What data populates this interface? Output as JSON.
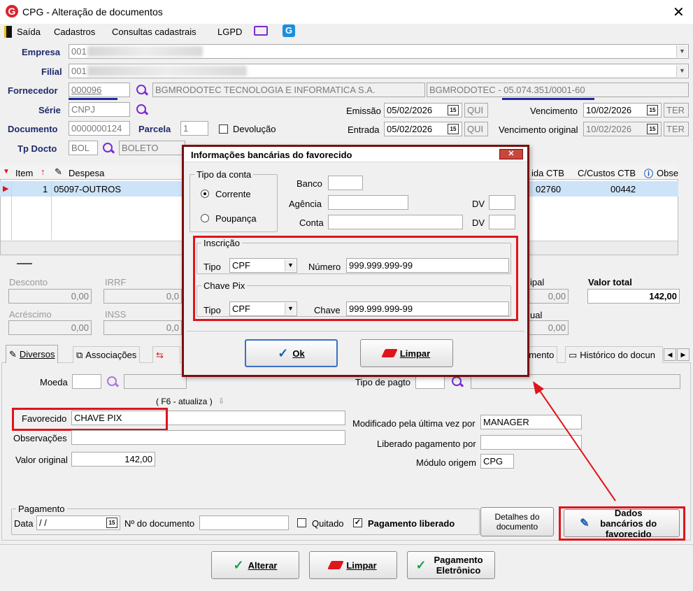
{
  "window": {
    "title": "CPG - Alteração de documentos"
  },
  "menu": {
    "saida": "Saída",
    "cadastros": "Cadastros",
    "consultas": "Consultas cadastrais",
    "lgpd": "LGPD"
  },
  "header": {
    "empresa_label": "Empresa",
    "empresa_value": "001",
    "filial_label": "Filial",
    "filial_value": "001",
    "fornecedor_label": "Fornecedor",
    "fornecedor_code": "000096",
    "fornecedor_name": "BGMRODOTEC TECNOLOGIA E INFORMATICA S.A.",
    "fornecedor_cnpj": "BGMRODOTEC - 05.074.351/0001-60",
    "serie_label": "Série",
    "serie_value": "CNPJ",
    "documento_label": "Documento",
    "documento_value": "0000000124",
    "parcela_label": "Parcela",
    "parcela_value": "1",
    "devolucao_label": "Devolução",
    "tpdocto_label": "Tp Docto",
    "tpdocto_code": "BOL",
    "tpdocto_name": "BOLETO",
    "emissao_label": "Emissão",
    "emissao_value": "05/02/2026",
    "emissao_day": "QUI",
    "entrada_label": "Entrada",
    "entrada_value": "05/02/2026",
    "entrada_day": "QUI",
    "vencimento_label": "Vencimento",
    "vencimento_value": "10/02/2026",
    "vencimento_day": "TER",
    "venc_original_label": "Vencimento original",
    "venc_original_value": "10/02/2026",
    "venc_original_day": "TER",
    "calendar_icon_text": "15"
  },
  "grid": {
    "col_item": "Item",
    "col_despesa": "Despesa",
    "col_ctb": "ida CTB",
    "col_ccustos": "C/Custos CTB",
    "col_obs": "Obse",
    "row1": {
      "item": "1",
      "despesa": "05097-OUTROS",
      "ctb": "02760",
      "ccustos": "00442"
    }
  },
  "totals": {
    "desconto_label": "Desconto",
    "desconto_value": "0,00",
    "irrf_label": "IRRF",
    "irrf_value": "0,0",
    "acrescimo_label": "Acréscimo",
    "acrescimo_value": "0,00",
    "inss_label": "INSS",
    "inss_value": "0,0",
    "principal_label": "ipal",
    "principal_value": "0,00",
    "ual_label": "ual",
    "ual_value": "0,00",
    "valor_total_label": "Valor total",
    "valor_total_value": "142,00"
  },
  "tabs": {
    "diversos": "Diversos",
    "associacoes": "Associações",
    "documento": "umento",
    "historico": "Histórico do docun"
  },
  "diversos": {
    "moeda_label": "Moeda",
    "f6_hint": "( F6 - atualiza )",
    "favorecido_label": "Favorecido",
    "favorecido_value": "CHAVE PIX",
    "observacoes_label": "Observações",
    "valor_original_label": "Valor original",
    "valor_original_value": "142,00",
    "tipo_pagto_label": "Tipo de pagto",
    "modificado_label": "Modificado pela última vez por",
    "modificado_value": "MANAGER",
    "liberado_label": "Liberado pagamento por",
    "modulo_label": "Módulo origem",
    "modulo_value": "CPG",
    "pagamento_legend": "Pagamento",
    "data_label": "Data",
    "data_value": " / /",
    "ndoc_label": "Nº do documento",
    "quitado_label": "Quitado",
    "pag_liberado_label": "Pagamento liberado",
    "detalhes_btn": "Detalhes do documento",
    "dados_bancarios_btn": "Dados bancários do favorecido"
  },
  "footer": {
    "alterar": "Alterar",
    "limpar": "Limpar",
    "pagamento_eletronico": "Pagamento Eletrônico"
  },
  "dialog": {
    "title": "Informações bancárias do favorecido",
    "tipo_conta_legend": "Tipo da conta",
    "corrente": "Corrente",
    "poupanca": "Poupança",
    "banco_label": "Banco",
    "agencia_label": "Agência",
    "conta_label": "Conta",
    "dv_label": "DV",
    "inscricao_legend": "Inscrição",
    "tipo_label": "Tipo",
    "inscricao_tipo": "CPF",
    "numero_label": "Número",
    "numero_value": "999.999.999-99",
    "chavepix_legend": "Chave Pix",
    "chave_tipo": "CPF",
    "chave_label": "Chave",
    "chave_value": "999.999.999-99",
    "ok_btn": "Ok",
    "limpar_btn": "Limpar"
  },
  "colors": {
    "accent_red": "#e0141b",
    "title_blue": "#1f2a6b",
    "purple": "#7b2bd1",
    "selection": "#cde3f7"
  }
}
